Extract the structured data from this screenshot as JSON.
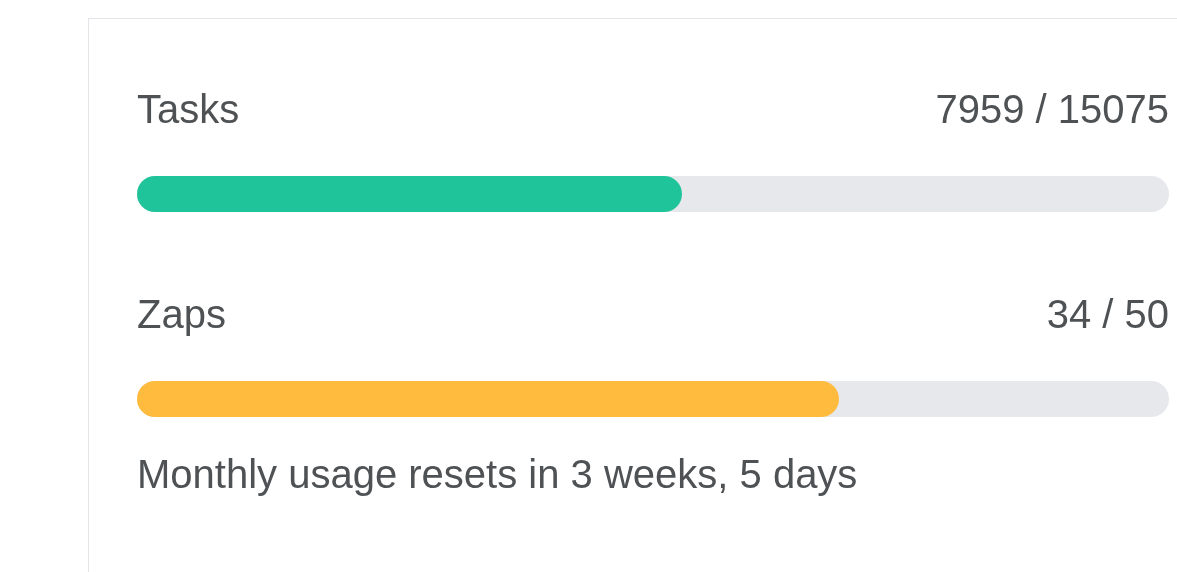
{
  "meters": [
    {
      "label": "Tasks",
      "reading": "7959 / 15075",
      "level": 0.528,
      "color": "#20c49b"
    },
    {
      "label": "Zaps",
      "reading": "34 / 50",
      "level": 0.68,
      "color": "#ffbb3d"
    }
  ],
  "reset_note": "Monthly usage resets in 3 weeks, 5 days"
}
